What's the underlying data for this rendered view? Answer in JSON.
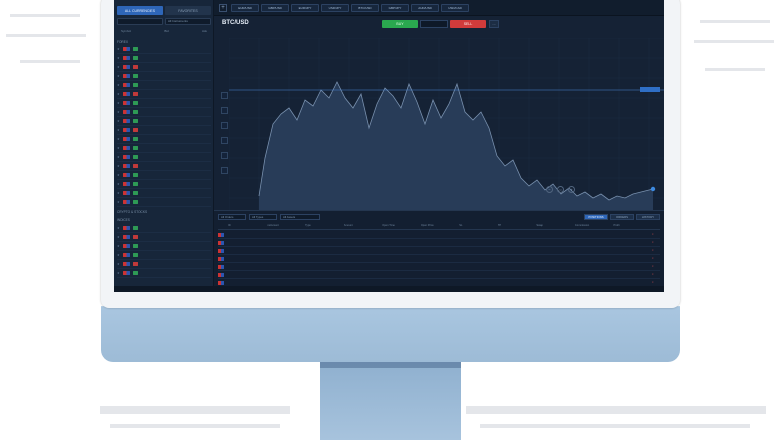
{
  "app": {
    "left_panel": {
      "tabs": [
        "ALL CURRENCIES",
        "FAVORITES"
      ],
      "filters": [
        "",
        "All Instruments"
      ],
      "columns": [
        "Symbol",
        "Bid",
        "Ask"
      ],
      "groups": [
        "FOREX",
        "CRYPTO & STOCKS",
        "INDICES"
      ],
      "footer": ""
    },
    "toolbar": {
      "tabs": [
        "EUR/USD",
        "GBP/USD",
        "EUR/JPY",
        "USD/JPY",
        "BTC/USD",
        "GBP/JPY",
        "AUD/USD",
        "USD/CAD"
      ]
    },
    "chart_header": {
      "symbol": "BTC/USD",
      "buy_label": "BUY",
      "mid_label": "",
      "sell_label": "SELL",
      "more_label": "..."
    },
    "chart": {
      "price_label": "",
      "colors": {
        "area": "#2a3f5c",
        "line": "#7890ae",
        "grid": "#1d2e45",
        "tag": "#2f6fc6"
      }
    },
    "bottom": {
      "selects": [
        "All Orders",
        "All Types",
        "All Assets"
      ],
      "buttons": [
        "POSITIONS",
        "ORDERS",
        "HISTORY"
      ],
      "columns": [
        "",
        "ID",
        "Instrument",
        "Type",
        "Amount",
        "Open Time",
        "Open Price",
        "SL",
        "TP",
        "Swap",
        "Commission",
        "Profit",
        ""
      ],
      "rows": [
        {
          "cells": [
            "",
            "",
            "",
            "",
            "",
            "",
            "",
            "",
            "",
            "",
            "",
            "",
            ""
          ]
        },
        {
          "cells": [
            "",
            "",
            "",
            "",
            "",
            "",
            "",
            "",
            "",
            "",
            "",
            "",
            ""
          ]
        },
        {
          "cells": [
            "",
            "",
            "",
            "",
            "",
            "",
            "",
            "",
            "",
            "",
            "",
            "",
            ""
          ]
        },
        {
          "cells": [
            "",
            "",
            "",
            "",
            "",
            "",
            "",
            "",
            "",
            "",
            "",
            "",
            ""
          ]
        },
        {
          "cells": [
            "",
            "",
            "",
            "",
            "",
            "",
            "",
            "",
            "",
            "",
            "",
            "",
            ""
          ]
        },
        {
          "cells": [
            "",
            "",
            "",
            "",
            "",
            "",
            "",
            "",
            "",
            "",
            "",
            "",
            ""
          ]
        },
        {
          "cells": [
            "",
            "",
            "",
            "",
            "",
            "",
            "",
            "",
            "",
            "",
            "",
            "",
            ""
          ]
        }
      ]
    },
    "status": {
      "left": "",
      "equity": "",
      "profit": "",
      "margin": "",
      "free": ""
    }
  }
}
